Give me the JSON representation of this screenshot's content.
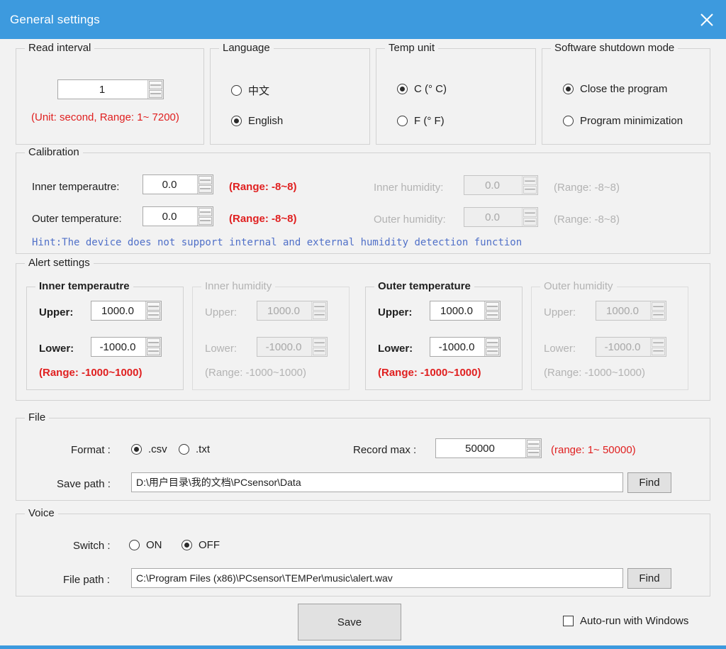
{
  "window": {
    "title": "General settings",
    "close_icon": "close-icon",
    "accent_color": "#3d9ade",
    "background_color": "#f2f2f2",
    "error_color": "#e02020",
    "hint_color": "#5070c8"
  },
  "read_interval": {
    "legend": "Read interval",
    "value": "1",
    "range_note": "(Unit: second, Range: 1~ 7200)"
  },
  "language": {
    "legend": "Language",
    "options": [
      {
        "label": "中文",
        "selected": false
      },
      {
        "label": "English",
        "selected": true
      }
    ]
  },
  "temp_unit": {
    "legend": "Temp unit",
    "options": [
      {
        "label": "C (° C)",
        "selected": true
      },
      {
        "label": "F (° F)",
        "selected": false
      }
    ]
  },
  "shutdown_mode": {
    "legend": "Software shutdown mode",
    "options": [
      {
        "label": "Close the program",
        "selected": true
      },
      {
        "label": "Program minimization",
        "selected": false
      }
    ]
  },
  "calibration": {
    "legend": "Calibration",
    "rows": [
      {
        "label": "Inner temperautre:",
        "value": "0.0",
        "range": "(Range: -8~8)",
        "disabled": false
      },
      {
        "label": "Outer temperature:",
        "value": "0.0",
        "range": "(Range: -8~8)",
        "disabled": false
      },
      {
        "label": "Inner humidity:",
        "value": "0.0",
        "range": "(Range: -8~8)",
        "disabled": true
      },
      {
        "label": "Outer humidity:",
        "value": "0.0",
        "range": "(Range: -8~8)",
        "disabled": true
      }
    ],
    "hint": "Hint:The device does not support internal and external humidity detection function"
  },
  "alert_settings": {
    "legend": "Alert settings",
    "groups": [
      {
        "legend": "Inner temperautre",
        "upper_label": "Upper:",
        "upper_value": "1000.0",
        "lower_label": "Lower:",
        "lower_value": "-1000.0",
        "range": "(Range: -1000~1000)",
        "disabled": false
      },
      {
        "legend": "Inner humidity",
        "upper_label": "Upper:",
        "upper_value": "1000.0",
        "lower_label": "Lower:",
        "lower_value": "-1000.0",
        "range": "(Range: -1000~1000)",
        "disabled": true
      },
      {
        "legend": "Outer temperature",
        "upper_label": "Upper:",
        "upper_value": "1000.0",
        "lower_label": "Lower:",
        "lower_value": "-1000.0",
        "range": "(Range: -1000~1000)",
        "disabled": false
      },
      {
        "legend": "Outer humidity",
        "upper_label": "Upper:",
        "upper_value": "1000.0",
        "lower_label": "Lower:",
        "lower_value": "-1000.0",
        "range": "(Range: -1000~1000)",
        "disabled": true
      }
    ]
  },
  "file": {
    "legend": "File",
    "format_label": "Format :",
    "format_options": [
      {
        "label": ".csv",
        "selected": true
      },
      {
        "label": ".txt",
        "selected": false
      }
    ],
    "record_max_label": "Record max :",
    "record_max_value": "50000",
    "record_max_range": "(range: 1~ 50000)",
    "save_path_label": "Save path :",
    "save_path_value": "D:\\用户目录\\我的文档\\PCsensor\\Data",
    "find_button": "Find"
  },
  "voice": {
    "legend": "Voice",
    "switch_label": "Switch :",
    "switch_options": [
      {
        "label": "ON",
        "selected": false
      },
      {
        "label": "OFF",
        "selected": true
      }
    ],
    "file_path_label": "File path :",
    "file_path_value": "C:\\Program Files (x86)\\PCsensor\\TEMPer\\music\\alert.wav",
    "find_button": "Find"
  },
  "footer": {
    "save_button": "Save",
    "autorun_label": "Auto-run with Windows",
    "autorun_checked": false
  }
}
